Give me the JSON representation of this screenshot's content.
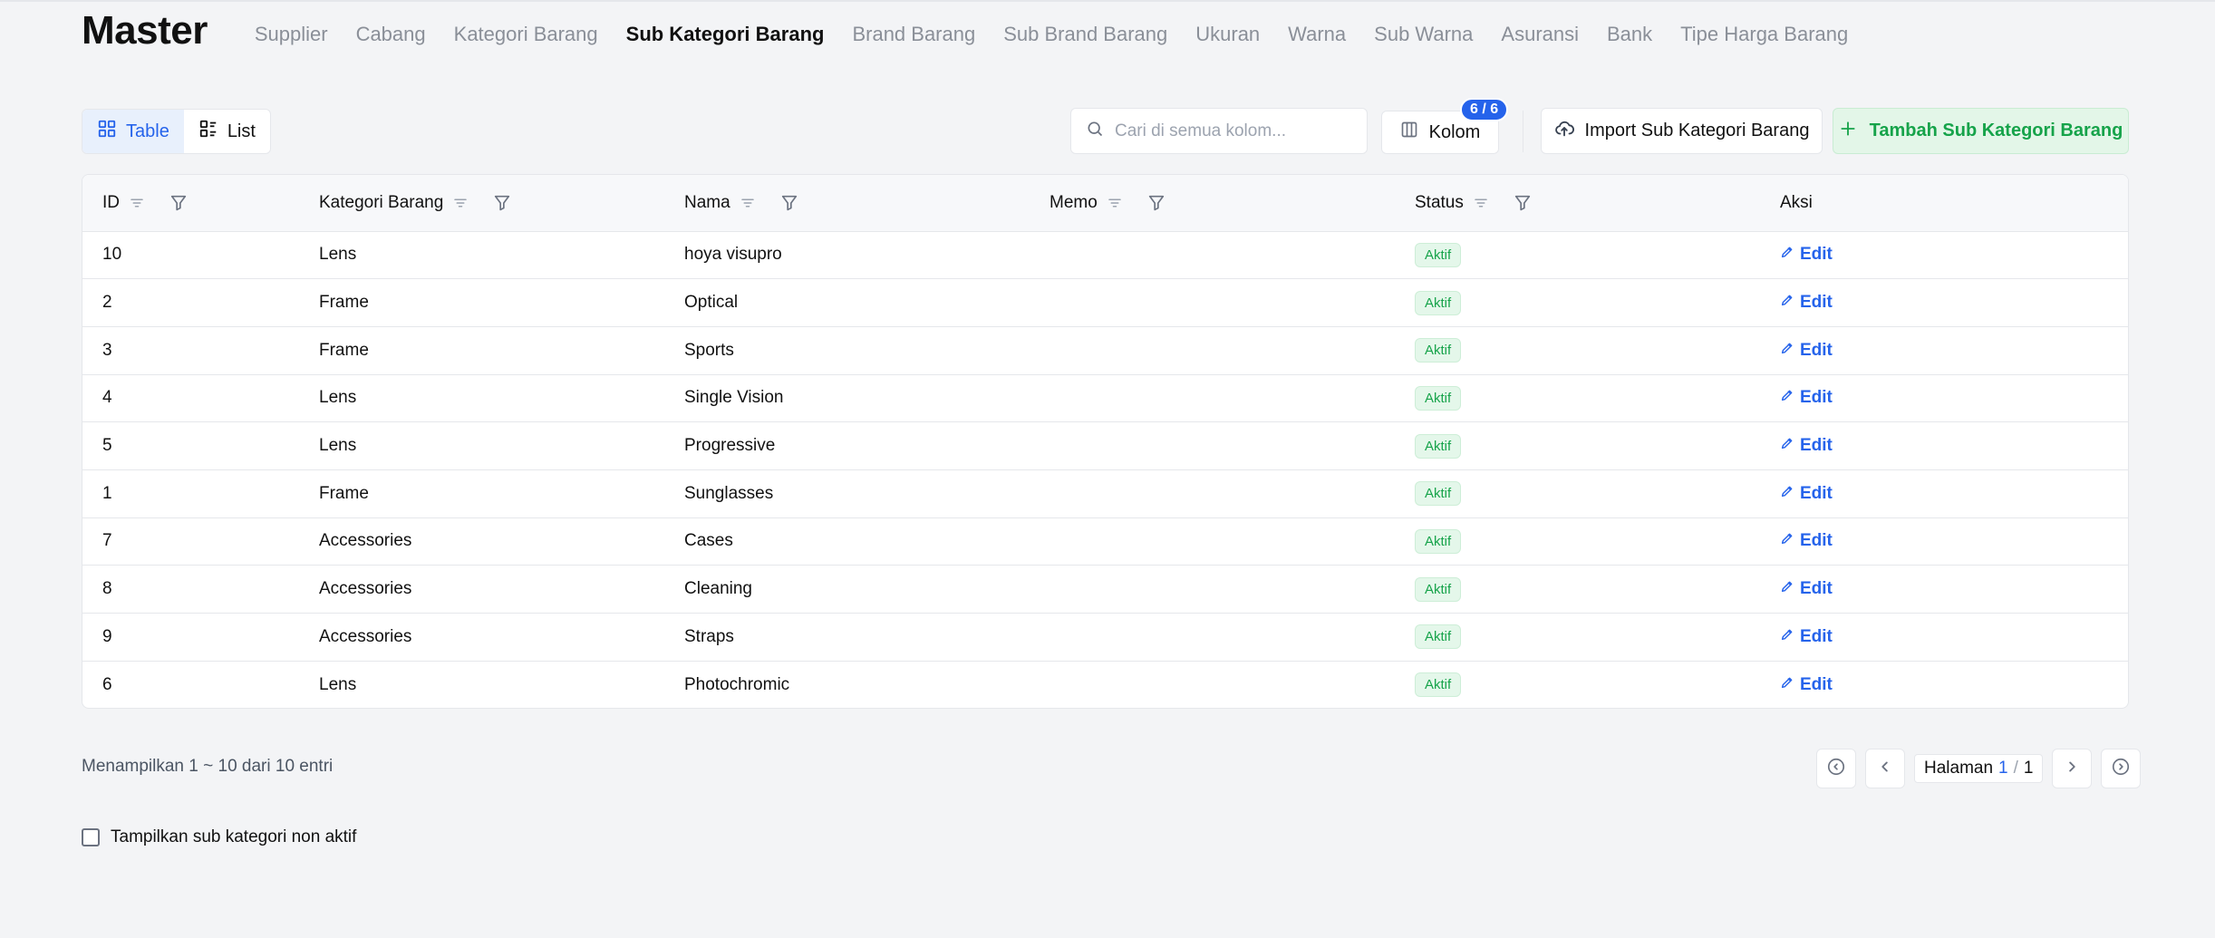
{
  "header": {
    "title": "Master",
    "nav": [
      {
        "label": "Supplier",
        "active": false
      },
      {
        "label": "Cabang",
        "active": false
      },
      {
        "label": "Kategori Barang",
        "active": false
      },
      {
        "label": "Sub Kategori Barang",
        "active": true
      },
      {
        "label": "Brand Barang",
        "active": false
      },
      {
        "label": "Sub Brand Barang",
        "active": false
      },
      {
        "label": "Ukuran",
        "active": false
      },
      {
        "label": "Warna",
        "active": false
      },
      {
        "label": "Sub Warna",
        "active": false
      },
      {
        "label": "Asuransi",
        "active": false
      },
      {
        "label": "Bank",
        "active": false
      },
      {
        "label": "Tipe Harga Barang",
        "active": false
      }
    ]
  },
  "toolbar": {
    "view_table_label": "Table",
    "view_list_label": "List",
    "search_placeholder": "Cari di semua kolom...",
    "search_value": "",
    "kolom_label": "Kolom",
    "kolom_badge": "6 / 6",
    "import_label": "Import Sub Kategori Barang",
    "add_label": "Tambah Sub Kategori Barang"
  },
  "table": {
    "columns": [
      {
        "label": "ID",
        "sortable": true,
        "filterable": true
      },
      {
        "label": "Kategori Barang",
        "sortable": true,
        "filterable": true
      },
      {
        "label": "Nama",
        "sortable": true,
        "filterable": true
      },
      {
        "label": "Memo",
        "sortable": true,
        "filterable": true
      },
      {
        "label": "Status",
        "sortable": true,
        "filterable": true
      },
      {
        "label": "Aksi",
        "sortable": false,
        "filterable": false
      }
    ],
    "edit_label": "Edit",
    "rows": [
      {
        "id": "10",
        "kategori": "Lens",
        "nama": "hoya visupro",
        "memo": "",
        "status": "Aktif"
      },
      {
        "id": "2",
        "kategori": "Frame",
        "nama": "Optical",
        "memo": "",
        "status": "Aktif"
      },
      {
        "id": "3",
        "kategori": "Frame",
        "nama": "Sports",
        "memo": "",
        "status": "Aktif"
      },
      {
        "id": "4",
        "kategori": "Lens",
        "nama": "Single Vision",
        "memo": "",
        "status": "Aktif"
      },
      {
        "id": "5",
        "kategori": "Lens",
        "nama": "Progressive",
        "memo": "",
        "status": "Aktif"
      },
      {
        "id": "1",
        "kategori": "Frame",
        "nama": "Sunglasses",
        "memo": "",
        "status": "Aktif"
      },
      {
        "id": "7",
        "kategori": "Accessories",
        "nama": "Cases",
        "memo": "",
        "status": "Aktif"
      },
      {
        "id": "8",
        "kategori": "Accessories",
        "nama": "Cleaning",
        "memo": "",
        "status": "Aktif"
      },
      {
        "id": "9",
        "kategori": "Accessories",
        "nama": "Straps",
        "memo": "",
        "status": "Aktif"
      },
      {
        "id": "6",
        "kategori": "Lens",
        "nama": "Photochromic",
        "memo": "",
        "status": "Aktif"
      }
    ]
  },
  "footer": {
    "entries_info": "Menampilkan 1 ~ 10 dari 10 entri",
    "page_label": "Halaman",
    "page_current": "1",
    "page_separator": "/",
    "page_total": "1",
    "show_inactive_label": "Tampilkan sub kategori non aktif"
  },
  "colors": {
    "accent": "#2563eb",
    "success": "#16a34a",
    "success_bg": "#e4f7ea"
  }
}
